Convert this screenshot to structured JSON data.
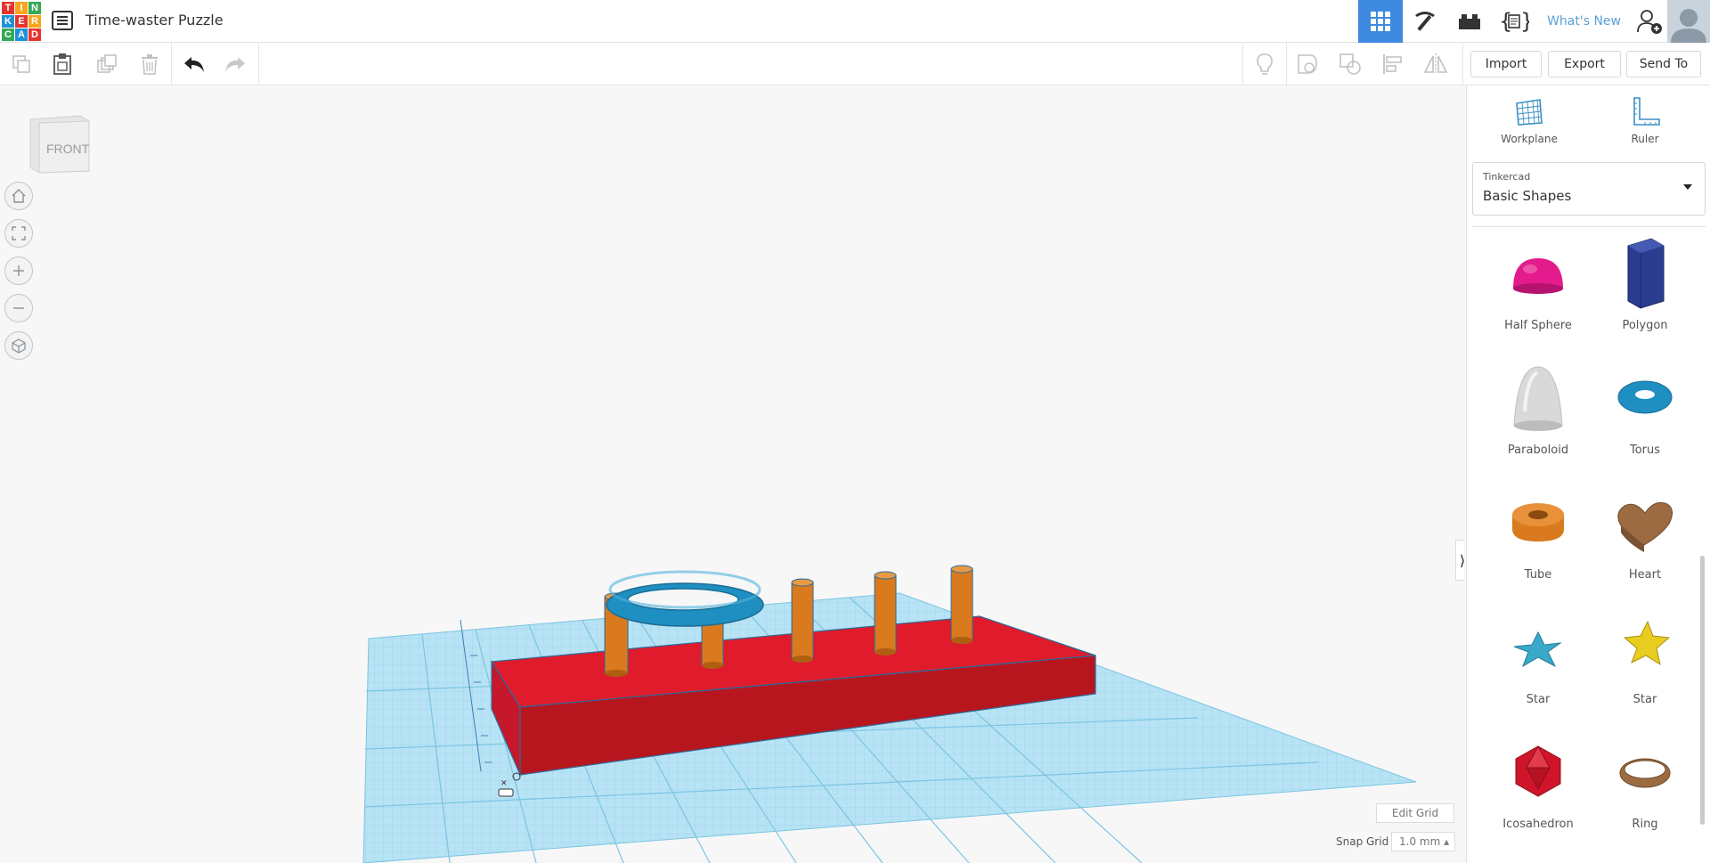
{
  "app": {
    "title": "Time-waster Puzzle",
    "logo_letters": [
      "T",
      "I",
      "N",
      "K",
      "E",
      "R",
      "C",
      "A",
      "D"
    ]
  },
  "topbar": {
    "whats_new": "What's New"
  },
  "toolbar": {
    "import": "Import",
    "export": "Export",
    "send_to": "Send To"
  },
  "viewcube": {
    "face": "FRONT"
  },
  "panel": {
    "workplane": "Workplane",
    "ruler": "Ruler",
    "library_category": "Tinkercad",
    "library_name": "Basic Shapes",
    "shapes": [
      {
        "name": "Half Sphere",
        "icon": "half-sphere-icon"
      },
      {
        "name": "Polygon",
        "icon": "polygon-icon"
      },
      {
        "name": "Paraboloid",
        "icon": "paraboloid-icon"
      },
      {
        "name": "Torus",
        "icon": "torus-icon"
      },
      {
        "name": "Tube",
        "icon": "tube-icon"
      },
      {
        "name": "Heart",
        "icon": "heart-icon"
      },
      {
        "name": "Star",
        "icon": "star-icon"
      },
      {
        "name": "Star",
        "icon": "star-icon"
      },
      {
        "name": "Icosahedron",
        "icon": "icosahedron-icon"
      },
      {
        "name": "Ring",
        "icon": "ring-icon"
      }
    ]
  },
  "grid": {
    "edit_grid": "Edit Grid",
    "snap_label": "Snap Grid",
    "snap_value": "1.0 mm ▴"
  },
  "colors": {
    "accent": "#3e8ae0",
    "base_red": "#e01b2b",
    "peg_orange": "#d97a1e",
    "torus_blue": "#1f8fc1",
    "grid_blue": "#a9dcf1"
  }
}
